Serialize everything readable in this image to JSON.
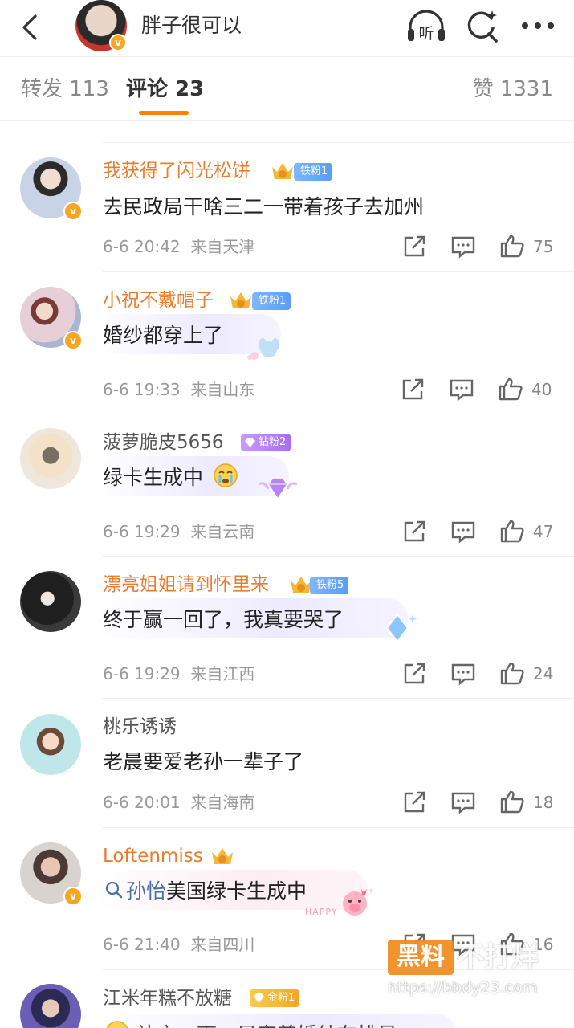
{
  "header": {
    "title": "胖子很可以",
    "listen_label": "听",
    "avatar_badge": "v"
  },
  "tabs": {
    "forward": "转发 113",
    "comments": "评论 23",
    "likes": "赞 1331"
  },
  "colors": {
    "accent": "#ff8200",
    "username_orange": "#e87d2f",
    "verified_badge": "#f6a623"
  },
  "comments": [
    {
      "username": "我获得了闪光松饼",
      "crown_level": "6",
      "fan_badge": "铁粉1",
      "text": "去民政局干啥三二一带着孩子去加州",
      "time": "6-6 20:42",
      "location": "来自天津",
      "likes": "75"
    },
    {
      "username": "小祝不戴帽子",
      "crown_level": "6",
      "fan_badge": "铁粉1",
      "text": "婚纱都穿上了",
      "time": "6-6 19:33",
      "location": "来自山东",
      "likes": "40"
    },
    {
      "username": "菠萝脆皮5656",
      "fan_badge": "钻粉2",
      "text": "绿卡生成中",
      "time": "6-6 19:29",
      "location": "来自云南",
      "likes": "47"
    },
    {
      "username": "漂亮姐姐请到怀里来",
      "crown_level": "7",
      "fan_badge": "铁粉5",
      "text": "终于赢一回了，我真要哭了",
      "time": "6-6 19:29",
      "location": "来自江西",
      "likes": "24"
    },
    {
      "username": "桃乐诱诱",
      "text": "老晨要爱老孙一辈子了",
      "time": "6-6 20:01",
      "location": "来自海南",
      "likes": "18"
    },
    {
      "username": "Loftenmiss",
      "crown_level": "6",
      "search_link": "孙怡",
      "text": "美国绿卡生成中",
      "time": "6-6 21:40",
      "location": "来自四川",
      "likes": "16",
      "sticker_text": "HAPPY"
    },
    {
      "username": "江米年糕不放糖",
      "fan_badge": "金粉1",
      "text": "补充一下，是穿着婚纱在排号"
    }
  ],
  "watermark": {
    "box": "黑料",
    "text": "不打烊",
    "url": "https://bbdy23.com"
  }
}
